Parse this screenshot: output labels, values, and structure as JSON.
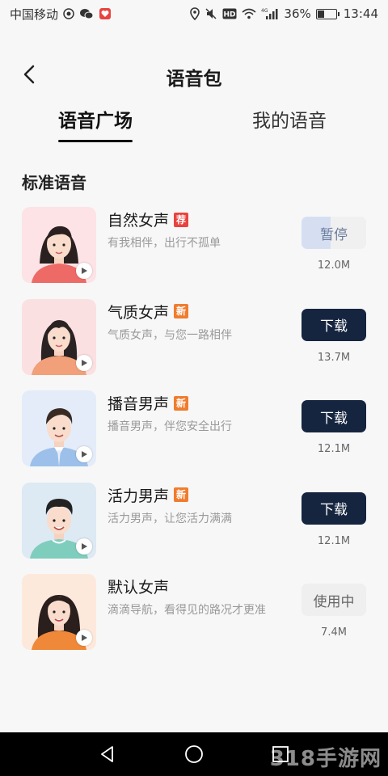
{
  "status_bar": {
    "carrier": "中国移动",
    "network_badge": "4G",
    "battery_percent": "36%",
    "battery_level": 0.36,
    "time": "13:44"
  },
  "header": {
    "title": "语音包",
    "back_icon": "chevron-left-icon"
  },
  "tabs": [
    {
      "label": "语音广场",
      "active": true
    },
    {
      "label": "我的语音",
      "active": false
    }
  ],
  "section_title": "标准语音",
  "voices": [
    {
      "name": "自然女声",
      "tag": "荐",
      "tag_color": "#e8433f",
      "desc": "有我相伴，出行不孤单",
      "action": "暂停",
      "action_state": "downloading",
      "download_progress": 0.45,
      "size": "12.0M"
    },
    {
      "name": "气质女声",
      "tag": "新",
      "tag_color": "#f07c2e",
      "desc": "气质女声，与您一路相伴",
      "action": "下载",
      "action_state": "download",
      "size": "13.7M"
    },
    {
      "name": "播音男声",
      "tag": "新",
      "tag_color": "#f07c2e",
      "desc": "播音男声，伴您安全出行",
      "action": "下载",
      "action_state": "download",
      "size": "12.1M"
    },
    {
      "name": "活力男声",
      "tag": "新",
      "tag_color": "#f07c2e",
      "desc": "活力男声，让您活力满满",
      "action": "下载",
      "action_state": "download",
      "size": "12.1M"
    },
    {
      "name": "默认女声",
      "tag": "",
      "desc": "滴滴导航，看得见的路况才更准",
      "action": "使用中",
      "action_state": "in_use",
      "size": "7.4M"
    }
  ],
  "nav_bar": {
    "back_icon": "triangle-back-icon",
    "home_icon": "circle-home-icon",
    "recents_icon": "square-recents-icon"
  },
  "watermark": "318手游网"
}
